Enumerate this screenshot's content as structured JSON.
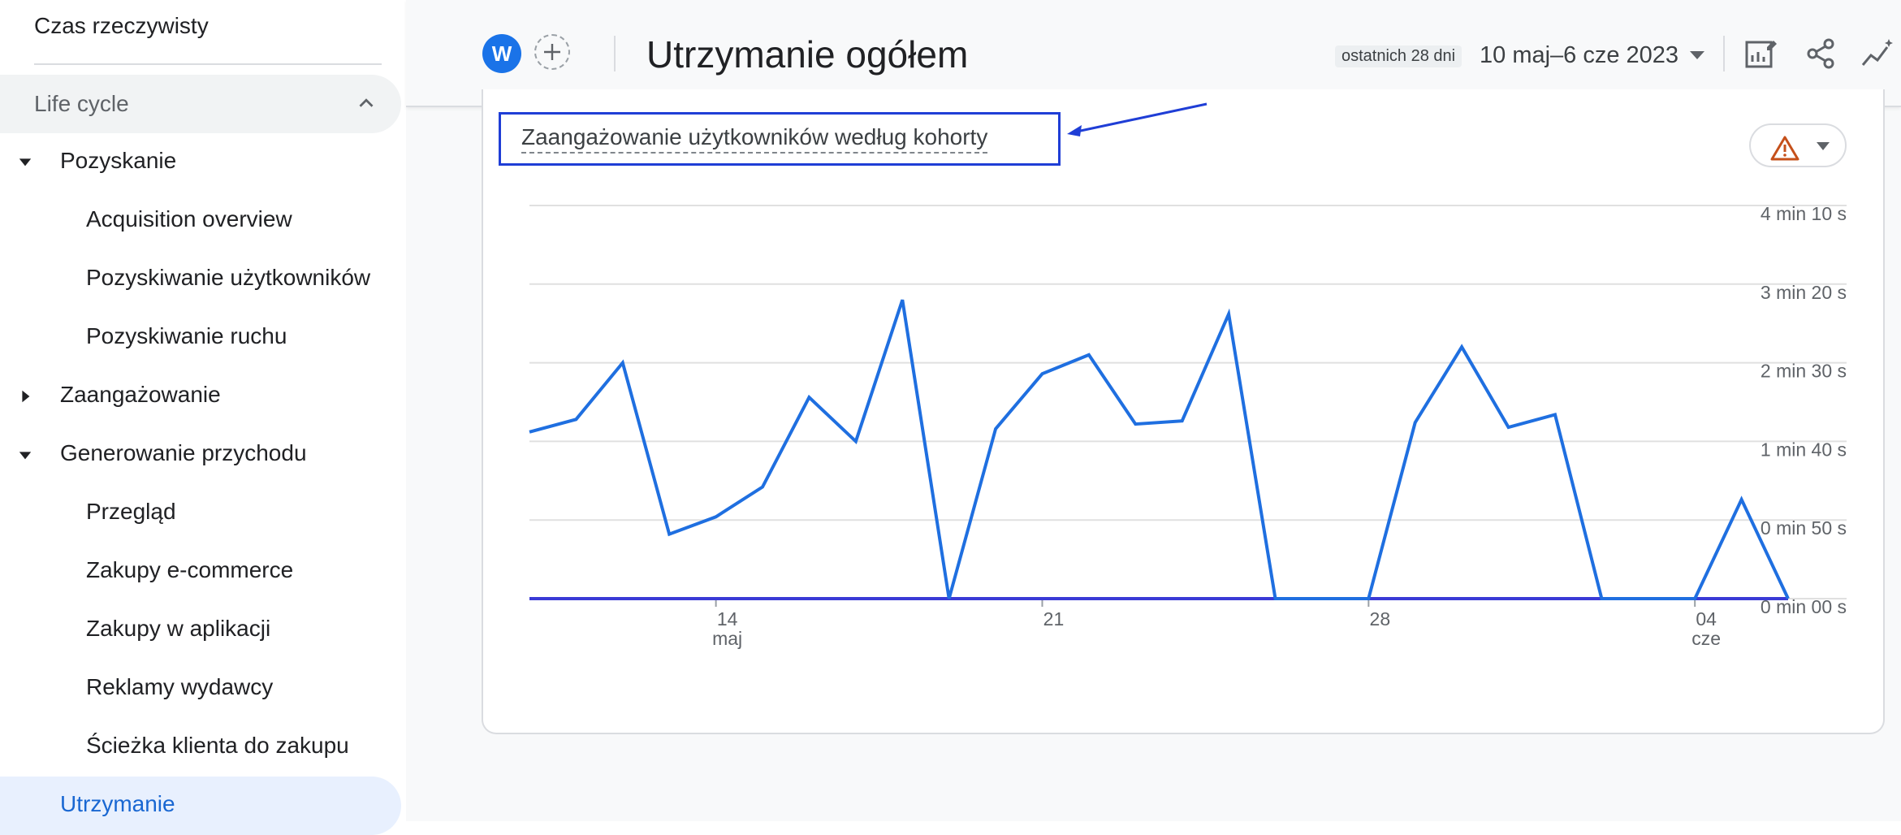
{
  "sidebar": {
    "realtime": "Czas rzeczywisty",
    "section": "Life cycle",
    "items": [
      {
        "label": "Pozyskanie"
      },
      {
        "label": "Acquisition overview"
      },
      {
        "label": "Pozyskiwanie użytkowników"
      },
      {
        "label": "Pozyskiwanie ruchu"
      },
      {
        "label": "Zaangażowanie"
      },
      {
        "label": "Generowanie przychodu"
      },
      {
        "label": "Przegląd"
      },
      {
        "label": "Zakupy e-commerce"
      },
      {
        "label": "Zakupy w aplikacji"
      },
      {
        "label": "Reklamy wydawcy"
      },
      {
        "label": "Ścieżka klienta do zakupu"
      },
      {
        "label": "Utrzymanie"
      }
    ]
  },
  "header": {
    "avatar_letter": "W",
    "title": "Utrzymanie ogółem",
    "date_chip": "ostatnich 28 dni",
    "date_range": "10 maj–6 cze 2023"
  },
  "card": {
    "title": "Zaangażowanie użytkowników według kohorty"
  },
  "colors": {
    "accent": "#1a73e8",
    "series_line": "#1f6fe0",
    "baseline_line": "#3a3ad6",
    "warning": "#c5501a",
    "annotation": "#1f3ed6"
  },
  "chart_data": {
    "type": "line",
    "title": "Zaangażowanie użytkowników według kohorty",
    "xlabel": "",
    "ylabel": "",
    "y_unit": "seconds",
    "ylim": [
      0,
      250
    ],
    "y_ticks": [
      {
        "value": 250,
        "label": "4 min 10 s"
      },
      {
        "value": 200,
        "label": "3 min 20 s"
      },
      {
        "value": 150,
        "label": "2 min 30 s"
      },
      {
        "value": 100,
        "label": "1 min 40 s"
      },
      {
        "value": 50,
        "label": "0 min 50 s"
      },
      {
        "value": 0,
        "label": "0 min 00 s"
      }
    ],
    "x_ticks": [
      {
        "day": "14",
        "month": "maj",
        "index": 4
      },
      {
        "day": "21",
        "month": "",
        "index": 11
      },
      {
        "day": "28",
        "month": "",
        "index": 18
      },
      {
        "day": "04",
        "month": "cze",
        "index": 25
      }
    ],
    "x": [
      "10 maj",
      "11 maj",
      "12 maj",
      "13 maj",
      "14 maj",
      "15 maj",
      "16 maj",
      "17 maj",
      "18 maj",
      "19 maj",
      "20 maj",
      "21 maj",
      "22 maj",
      "23 maj",
      "24 maj",
      "25 maj",
      "26 maj",
      "27 maj",
      "28 maj",
      "29 maj",
      "30 maj",
      "31 maj",
      "1 cze",
      "2 cze",
      "3 cze",
      "4 cze",
      "5 cze",
      "6 cze"
    ],
    "series": [
      {
        "values": [
          106,
          114,
          150,
          41,
          52,
          71,
          128,
          100,
          190,
          0,
          108,
          143,
          155,
          111,
          113,
          181,
          0,
          0,
          0,
          112,
          160,
          109,
          117,
          0,
          0,
          0,
          63,
          0
        ]
      },
      {
        "values": [
          0,
          0,
          0,
          0,
          0,
          0,
          0,
          0,
          0,
          0,
          0,
          0,
          0,
          0,
          0,
          0,
          0,
          0,
          0,
          0,
          0,
          0,
          0,
          0,
          0,
          0,
          0,
          0
        ]
      }
    ],
    "grid": true
  }
}
